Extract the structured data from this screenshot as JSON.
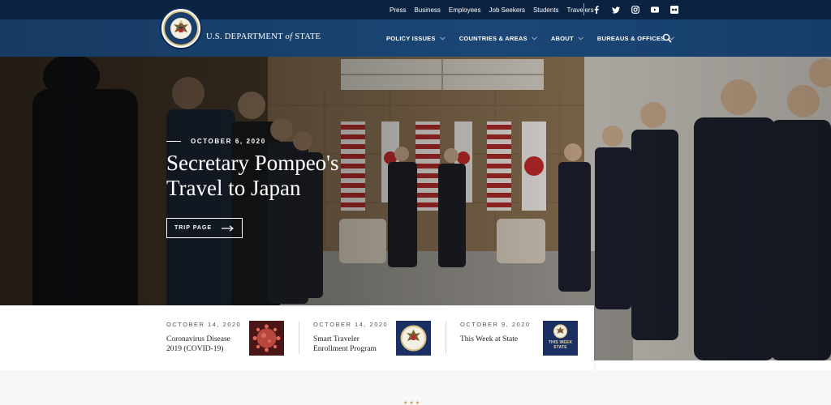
{
  "utility_nav": {
    "links": [
      "Press",
      "Business",
      "Employees",
      "Job Seekers",
      "Students",
      "Travelers"
    ]
  },
  "social_icons": [
    "facebook-icon",
    "twitter-icon",
    "instagram-icon",
    "youtube-icon",
    "flickr-icon"
  ],
  "header": {
    "brand_pre": "U.S. DEPARTMENT ",
    "brand_of": "of",
    "brand_post": " STATE",
    "nav": [
      "POLICY ISSUES",
      "COUNTRIES & AREAS",
      "ABOUT",
      "BUREAUS & OFFICES"
    ]
  },
  "hero": {
    "date": "OCTOBER 6, 2020",
    "title": "Secretary Pompeo's Travel to Japan",
    "button": "TRIP PAGE"
  },
  "news": [
    {
      "date": "OCTOBER 14, 2020",
      "title": "Coronavirus Disease 2019 (COVID-19)"
    },
    {
      "date": "OCTOBER 14, 2020",
      "title": "Smart Traveler Enrollment Program"
    },
    {
      "date": "OCTOBER 9, 2020",
      "title": "This Week at State",
      "thumb_text": "THIS WEEK STATE"
    }
  ],
  "colors": {
    "top_bar": "#0b2341",
    "header": "#1b4675",
    "accent_gold": "#c49a56"
  }
}
